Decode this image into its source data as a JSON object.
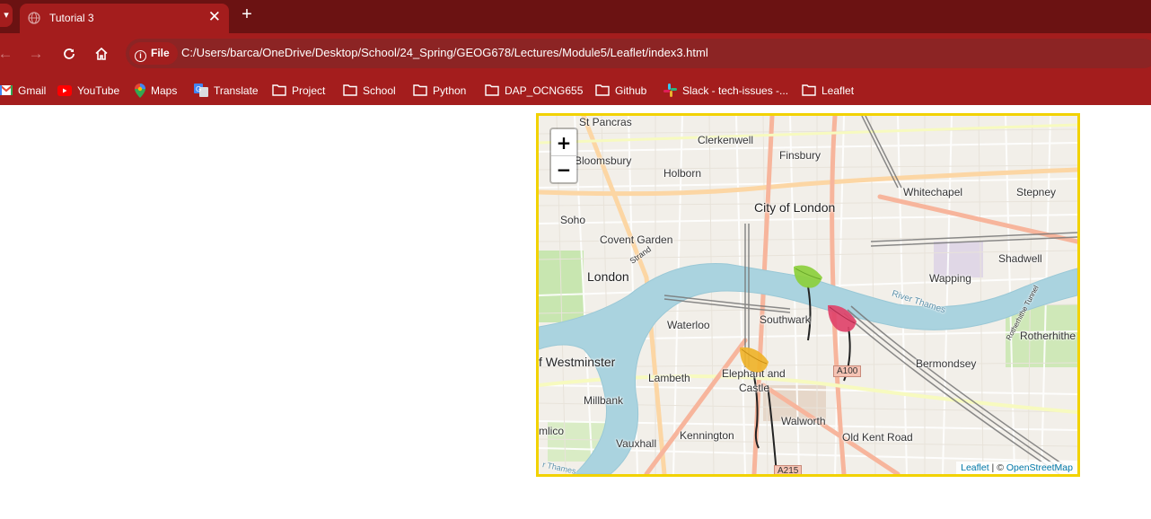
{
  "browser": {
    "tab": {
      "title": "Tutorial 3",
      "close_icon": "close-icon"
    },
    "new_tab_label": "+",
    "address": {
      "chip_label": "File",
      "url": "C:/Users/barca/OneDrive/Desktop/School/24_Spring/GEOG678/Lectures/Module5/Leaflet/index3.html"
    },
    "bookmarks": [
      {
        "label": "Gmail",
        "icon": "gmail-icon"
      },
      {
        "label": "YouTube",
        "icon": "youtube-icon"
      },
      {
        "label": "Maps",
        "icon": "maps-icon"
      },
      {
        "label": "Translate",
        "icon": "translate-icon"
      },
      {
        "label": "Project",
        "icon": "folder-icon"
      },
      {
        "label": "School",
        "icon": "folder-icon"
      },
      {
        "label": "Python",
        "icon": "folder-icon"
      },
      {
        "label": "DAP_OCNG655",
        "icon": "folder-icon"
      },
      {
        "label": "Github",
        "icon": "folder-icon"
      },
      {
        "label": "Slack - tech-issues -...",
        "icon": "slack-icon"
      },
      {
        "label": "Leaflet",
        "icon": "folder-icon"
      }
    ]
  },
  "map": {
    "zoom_in": "+",
    "zoom_out": "−",
    "labels": {
      "st_pancras": "St Pancras",
      "clerkenwell": "Clerkenwell",
      "bloomsbury": "Bloomsbury",
      "holborn": "Holborn",
      "finsbury": "Finsbury",
      "whitechapel": "Whitechapel",
      "stepney": "Stepney",
      "soho": "Soho",
      "city_of_london": "City of London",
      "covent_garden": "Covent Garden",
      "strand": "Strand",
      "london": "London",
      "shadwell": "Shadwell",
      "wapping": "Wapping",
      "river_thames": "River Thames",
      "rotherhithe_tunnel": "Rotherhithe Tunnel",
      "waterloo": "Waterloo",
      "southwark": "Southwark",
      "rotherhithe": "Rotherhithe",
      "westminster": "f Westminster",
      "bermondsey": "Bermondsey",
      "lambeth": "Lambeth",
      "elephant": "Elephant and",
      "castle": "Castle",
      "millbank": "Millbank",
      "walworth": "Walworth",
      "mlico": "mlico",
      "vauxhall": "Vauxhall",
      "kennington": "Kennington",
      "old_kent_road": "Old Kent Road",
      "a100": "A100",
      "a215": "A215",
      "thames_sw": "r Thames"
    },
    "attribution": {
      "leaflet": "Leaflet",
      "separator": " | © ",
      "osm": "OpenStreetMap"
    },
    "markers": [
      {
        "name": "marker-green-leaf",
        "color": "#8ccf3c"
      },
      {
        "name": "marker-red-leaf",
        "color": "#e0436a"
      },
      {
        "name": "marker-orange-leaf",
        "color": "#efb32a"
      }
    ]
  },
  "colors": {
    "tabstrip": "#6b1212",
    "toolbar": "#a41d1d",
    "map_border": "#f2d200"
  }
}
